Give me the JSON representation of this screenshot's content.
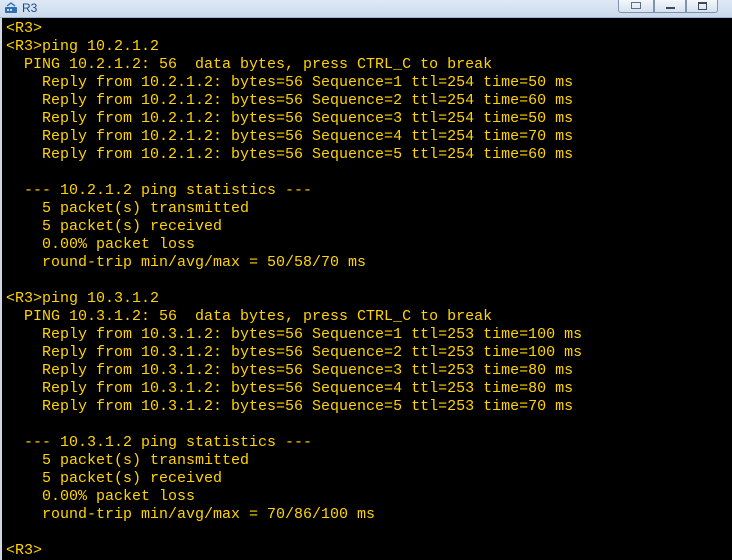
{
  "window": {
    "title": "R3"
  },
  "colors": {
    "terminal_background": "#000000",
    "terminal_text": "#ffd400"
  },
  "terminal": {
    "lines": [
      "<R3>",
      "<R3>ping 10.2.1.2",
      "  PING 10.2.1.2: 56  data bytes, press CTRL_C to break",
      "    Reply from 10.2.1.2: bytes=56 Sequence=1 ttl=254 time=50 ms",
      "    Reply from 10.2.1.2: bytes=56 Sequence=2 ttl=254 time=60 ms",
      "    Reply from 10.2.1.2: bytes=56 Sequence=3 ttl=254 time=50 ms",
      "    Reply from 10.2.1.2: bytes=56 Sequence=4 ttl=254 time=70 ms",
      "    Reply from 10.2.1.2: bytes=56 Sequence=5 ttl=254 time=60 ms",
      "",
      "  --- 10.2.1.2 ping statistics ---",
      "    5 packet(s) transmitted",
      "    5 packet(s) received",
      "    0.00% packet loss",
      "    round-trip min/avg/max = 50/58/70 ms",
      "",
      "<R3>ping 10.3.1.2",
      "  PING 10.3.1.2: 56  data bytes, press CTRL_C to break",
      "    Reply from 10.3.1.2: bytes=56 Sequence=1 ttl=253 time=100 ms",
      "    Reply from 10.3.1.2: bytes=56 Sequence=2 ttl=253 time=100 ms",
      "    Reply from 10.3.1.2: bytes=56 Sequence=3 ttl=253 time=80 ms",
      "    Reply from 10.3.1.2: bytes=56 Sequence=4 ttl=253 time=80 ms",
      "    Reply from 10.3.1.2: bytes=56 Sequence=5 ttl=253 time=70 ms",
      "",
      "  --- 10.3.1.2 ping statistics ---",
      "    5 packet(s) transmitted",
      "    5 packet(s) received",
      "    0.00% packet loss",
      "    round-trip min/avg/max = 70/86/100 ms",
      "",
      "<R3>"
    ]
  }
}
